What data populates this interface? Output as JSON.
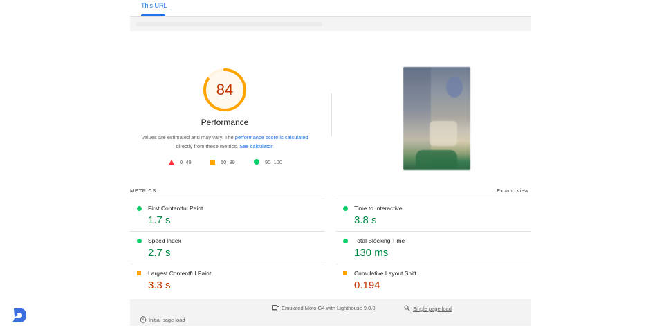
{
  "tabs": {
    "active": "This URL"
  },
  "gauge": {
    "score": "84",
    "score_fraction": 0.84,
    "title": "Performance",
    "desc_prefix": "Values are estimated and may vary. The ",
    "desc_link1": "performance score is calculated",
    "desc_mid": "directly from these metrics. ",
    "desc_link2": "See calculator.",
    "ring_color": "#ffa400",
    "ring_bg": "#fff3e0"
  },
  "legend": [
    {
      "shape": "triangle",
      "range": "0–49",
      "color": "#ff3333"
    },
    {
      "shape": "square",
      "range": "50–89",
      "color": "#ffa400"
    },
    {
      "shape": "circle",
      "range": "90–100",
      "color": "#0cce6b"
    }
  ],
  "metrics": {
    "label": "METRICS",
    "expand": "Expand view",
    "items": [
      {
        "name": "First Contentful Paint",
        "value": "1.7 s",
        "status": "pass"
      },
      {
        "name": "Time to Interactive",
        "value": "3.8 s",
        "status": "pass"
      },
      {
        "name": "Speed Index",
        "value": "2.7 s",
        "status": "pass"
      },
      {
        "name": "Total Blocking Time",
        "value": "130 ms",
        "status": "pass"
      },
      {
        "name": "Largest Contentful Paint",
        "value": "3.3 s",
        "status": "average"
      },
      {
        "name": "Cumulative Layout Shift",
        "value": "0.194",
        "status": "average"
      }
    ]
  },
  "footer": {
    "device": "Emulated Moto G4 with Lighthouse 9.0.0",
    "load_type": "Single page load",
    "initial": "Initial page load"
  },
  "icons": {
    "device": "device-icon",
    "single_page": "single-page-icon",
    "timer": "timer-icon",
    "brand": "brand-logo"
  },
  "colors": {
    "pass": "#018642",
    "average": "#c33300",
    "accent": "#1a73e8"
  }
}
